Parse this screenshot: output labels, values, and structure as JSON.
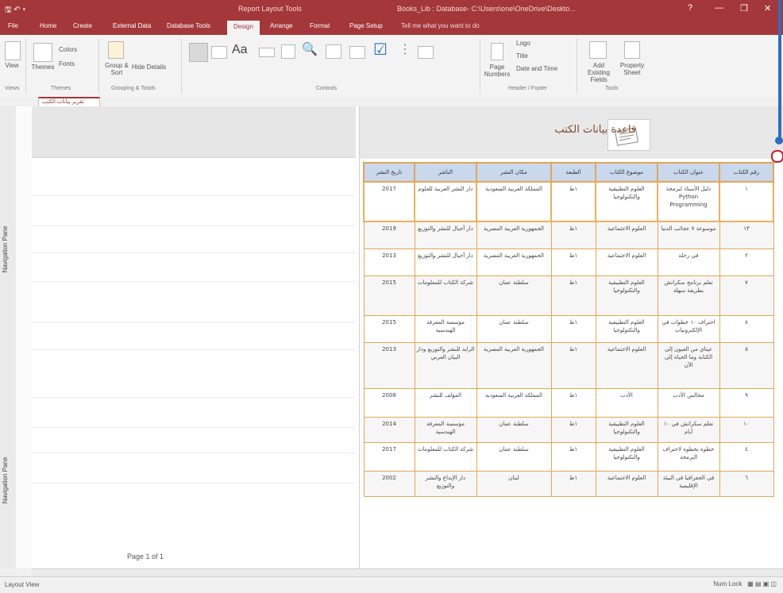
{
  "window": {
    "qat": "🖫 ↶ ▾",
    "context_title": "Report Layout Tools",
    "doc_title": "Books_Lib : Database- C:\\Users\\one\\OneDrive\\Deskto...",
    "controls": [
      "?",
      "—",
      "❐",
      "✕"
    ]
  },
  "tabs": [
    "File",
    "Home",
    "Create",
    "External Data",
    "Database Tools",
    "Design",
    "Arrange",
    "Format",
    "Page Setup"
  ],
  "active_tab_index": 5,
  "tell_me": "Tell me what you want to do",
  "ribbon": {
    "views": "View",
    "themes": "Themes",
    "colors": "Colors",
    "fonts": "Fonts",
    "group_by": "Group & Sort",
    "hide_details": "Hide Details",
    "logo": "Logo",
    "title": "Title",
    "date_time": "Date and Time",
    "page_numbers": "Page Numbers",
    "add_existing_fields": "Add Existing Fields",
    "property_sheet": "Property Sheet",
    "groups": [
      "Views",
      "Themes",
      "Grouping & Totals",
      "Controls",
      "Header / Footer",
      "Tools"
    ]
  },
  "doc_tab": "تقرير بيانات الكتب",
  "nav_pane_label": "Navigation Pane",
  "report": {
    "title": "قاعدة بيانات الكتب",
    "columns": [
      "رقم الكتاب",
      "عنوان الكتاب",
      "موضوع الكتاب",
      "الطبعة",
      "مكان النشر",
      "الناشر",
      "تاريخ النشر"
    ],
    "rows": [
      [
        "١",
        "دليل الأستاذ لبرمجة Python Programming",
        "العلوم التطبيقية والتكنولوجيا",
        "١ط",
        "المملكة العربية السعودية",
        "دار النشر العربية للعلوم",
        "2017"
      ],
      [
        "١٣",
        "موسوعة ٧ عجائب الدنيا",
        "العلوم الاجتماعية",
        "١ط",
        "الجمهورية العربية المصرية",
        "دار أجيال للنشر والتوزيع",
        "2019"
      ],
      [
        "٢",
        "في رحلة",
        "العلوم الاجتماعية",
        "١ط",
        "الجمهورية العربية المصرية",
        "دار أجيال للنشر والتوزيع",
        "2013"
      ],
      [
        "٧",
        "تعلم برنامج سكراتش بطريقة سهلة",
        "العلوم التطبيقية والتكنولوجيا",
        "١ط",
        "سلطنة عمان",
        "شركة الكتاب للمعلومات",
        "2015"
      ],
      [
        "٨",
        "احتراف ١٠ خطوات في الإلكترونيات",
        "العلوم التطبيقية والتكنولوجيا",
        "١ط",
        "سلطنة عمان",
        "مؤسسة المعرفة الهندسية",
        "2015"
      ],
      [
        "٥",
        "عيناي من العيون إلى الكتابة وما الحياة إلى الآن",
        "العلوم الاجتماعية",
        "١ط",
        "الجمهورية العربية المصرية",
        "الراية للنشر والتوزيع ودار البيان العربي",
        "2013"
      ],
      [
        "٩",
        "مجالس الأدب",
        "الأدب",
        "١ط",
        "المملكة العربية السعودية",
        "المؤلف للنشر",
        "2008"
      ],
      [
        "١٠",
        "تعلم سكراتش في ١٠ أيام",
        "العلوم التطبيقية والتكنولوجيا",
        "١ط",
        "سلطنة عمان",
        "مؤسسة المعرفة الهندسية",
        "2014"
      ],
      [
        "٤",
        "خطوة بخطوة لاحتراف البرمجة",
        "العلوم التطبيقية والتكنولوجيا",
        "١ط",
        "سلطنة عمان",
        "شركة الكتاب للمعلومات",
        "2017"
      ],
      [
        "٦",
        "في الجغرافيا في البيئة الإقليمية",
        "العلوم الاجتماعية",
        "١ط",
        "لبنان",
        "دار الإبداع والنشر والتوزيع",
        "2002"
      ]
    ],
    "page_footer": "Page 1 of 1"
  },
  "status": {
    "left": "Layout View",
    "right": "Num Lock"
  }
}
